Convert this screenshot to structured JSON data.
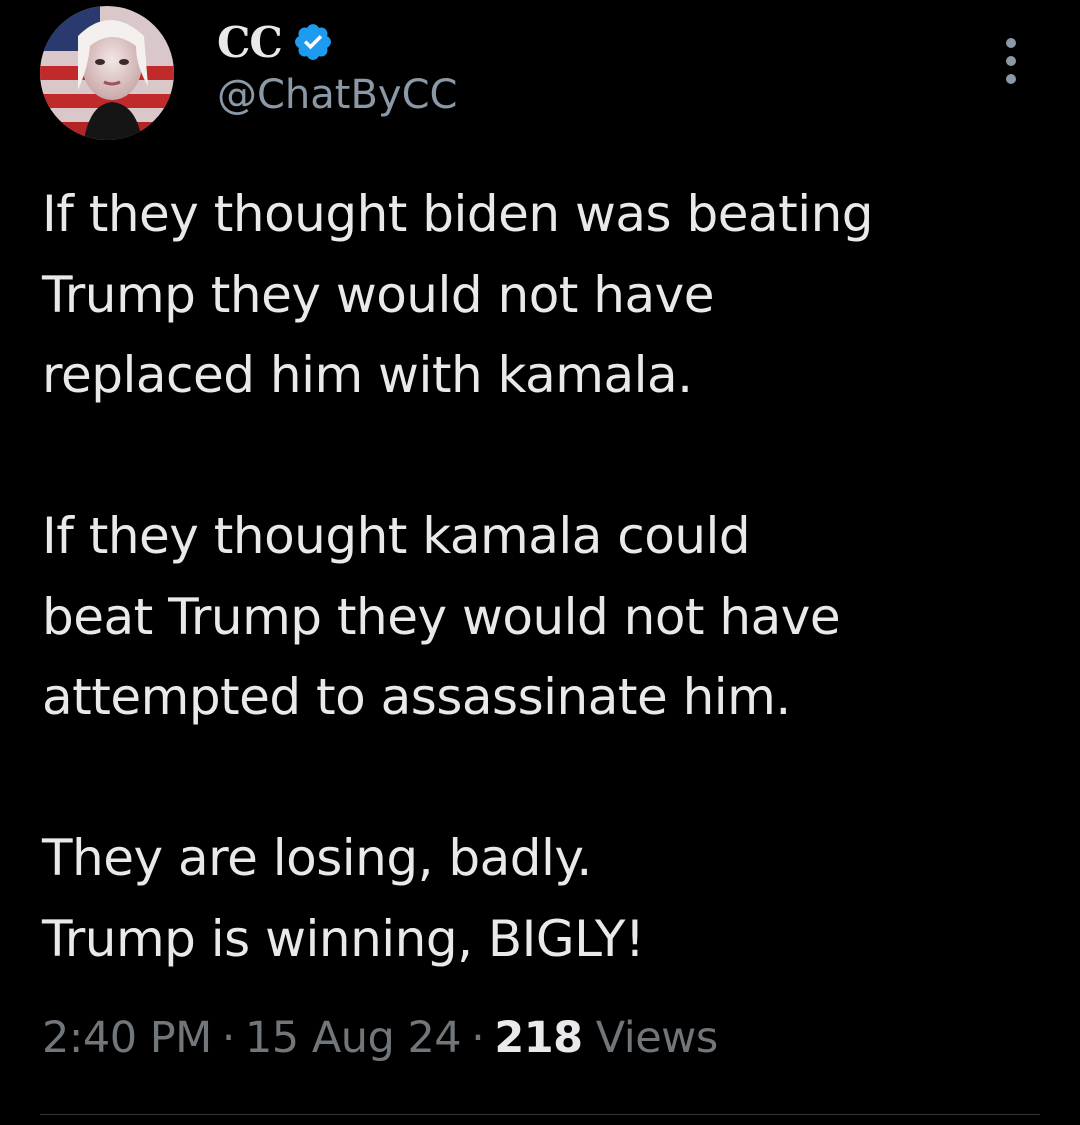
{
  "author": {
    "display_name": "CC",
    "handle": "@ChatByCC",
    "verified": true
  },
  "tweet": {
    "paragraphs": [
      [
        "If they thought biden was beating",
        "Trump they would not have",
        "replaced him with kamala."
      ],
      [
        "If they thought kamala could",
        "beat Trump they would not have",
        "attempted to assassinate him."
      ],
      [
        "They are losing, badly.",
        "Trump is winning, BIGLY!"
      ]
    ],
    "time": "2:40 PM",
    "date": "15 Aug 24",
    "separator": "·",
    "views_count": "218",
    "views_label": "Views"
  },
  "icons": {
    "verified": "verified-badge-icon",
    "more": "more-options-icon"
  },
  "colors": {
    "background": "#000000",
    "text_primary": "#e7e9ea",
    "text_secondary": "#71767b",
    "verified_blue": "#1d9bf0"
  }
}
